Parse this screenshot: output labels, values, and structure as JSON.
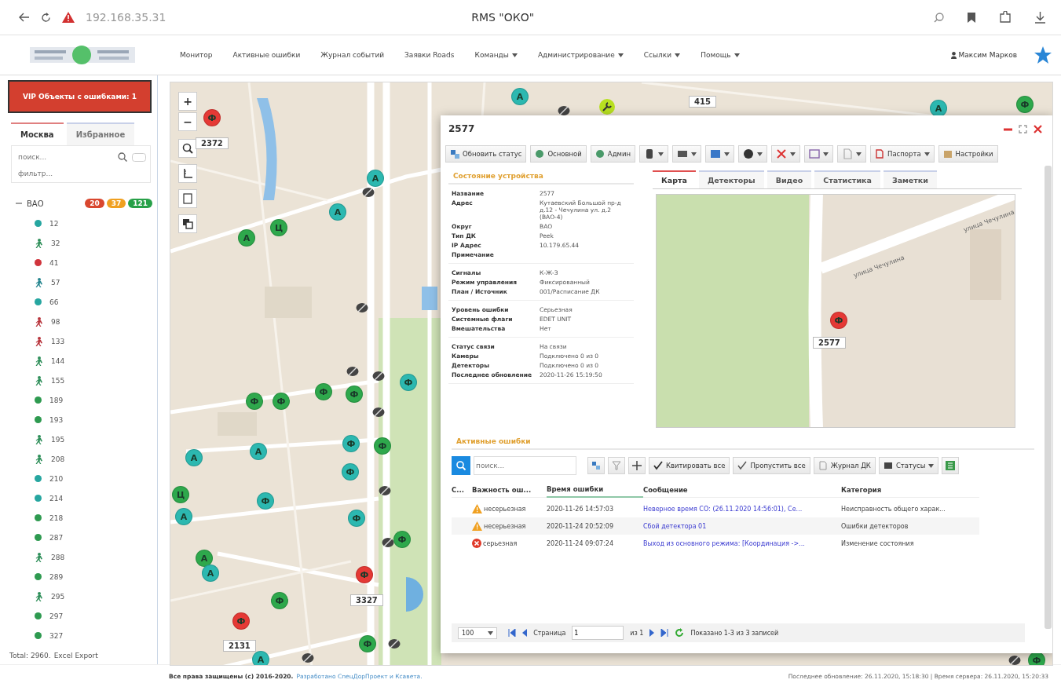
{
  "browser": {
    "address": "192.168.35.31",
    "title": "RMS \"ОКО\""
  },
  "nav": {
    "items": [
      {
        "label": "Монитор",
        "dropdown": false
      },
      {
        "label": "Активные ошибки",
        "dropdown": false
      },
      {
        "label": "Журнал событий",
        "dropdown": false
      },
      {
        "label": "Заявки Roads",
        "dropdown": false
      },
      {
        "label": "Команды",
        "dropdown": true
      },
      {
        "label": "Администрирование",
        "dropdown": true
      },
      {
        "label": "Ссылки",
        "dropdown": true
      },
      {
        "label": "Помощь",
        "dropdown": true
      }
    ],
    "user": "Максим Марков"
  },
  "sidebar": {
    "vip_banner": "VIP Объекты с ошибками: 1",
    "tabs": [
      {
        "label": "Москва",
        "selected": true
      },
      {
        "label": "Избранное",
        "selected": false
      }
    ],
    "search": {
      "placeholder": "поиск..."
    },
    "filter": {
      "placeholder": "фильтр..."
    },
    "tree": [
      {
        "label": "ВАО",
        "expanded": true,
        "counts": [
          {
            "text": "20",
            "color": "#d9472f"
          },
          {
            "text": "37",
            "color": "#f0a020"
          },
          {
            "text": "121",
            "color": "#27a048"
          }
        ],
        "children": [
          {
            "label": "12",
            "kind": "dot",
            "color": "#26a6a0"
          },
          {
            "label": "32",
            "kind": "walker",
            "color": "#2f8f5a"
          },
          {
            "label": "41",
            "kind": "dot",
            "color": "#d0343c"
          },
          {
            "label": "57",
            "kind": "walker",
            "color": "#26868f"
          },
          {
            "label": "66",
            "kind": "dot",
            "color": "#26a6a0"
          },
          {
            "label": "98",
            "kind": "walker",
            "color": "#b8343c"
          },
          {
            "label": "133",
            "kind": "walker",
            "color": "#b8343c"
          },
          {
            "label": "144",
            "kind": "walker",
            "color": "#2f8f5a"
          },
          {
            "label": "155",
            "kind": "walker",
            "color": "#2f8f5a"
          },
          {
            "label": "189",
            "kind": "dot",
            "color": "#2e9a50"
          },
          {
            "label": "193",
            "kind": "dot",
            "color": "#2e9a50"
          },
          {
            "label": "195",
            "kind": "walker",
            "color": "#2f8f5a"
          },
          {
            "label": "208",
            "kind": "walker",
            "color": "#2f8f5a"
          },
          {
            "label": "210",
            "kind": "dot",
            "color": "#26a6a0"
          },
          {
            "label": "214",
            "kind": "dot",
            "color": "#26a6a0"
          },
          {
            "label": "218",
            "kind": "dot",
            "color": "#2e9a50"
          },
          {
            "label": "287",
            "kind": "dot",
            "color": "#2e9a50"
          },
          {
            "label": "288",
            "kind": "walker",
            "color": "#2f8f5a"
          },
          {
            "label": "289",
            "kind": "dot",
            "color": "#2e9a50"
          },
          {
            "label": "295",
            "kind": "walker",
            "color": "#2f8f5a"
          },
          {
            "label": "297",
            "kind": "dot",
            "color": "#2e9a50"
          },
          {
            "label": "327",
            "kind": "dot",
            "color": "#2e9a50"
          }
        ]
      }
    ],
    "total": "Total: 2960.",
    "export_link": "Excel Export"
  },
  "map": {
    "controls": [
      "+",
      "−"
    ],
    "markers": [
      {
        "letter": "Ф",
        "color": "#e53935"
      },
      {
        "letter": "А",
        "color": "#2cb8b0"
      },
      {
        "letter": "А",
        "color": "#2cb8b0"
      },
      {
        "letter": "Ф",
        "color": "#2ea84c"
      },
      {
        "letter": "А",
        "color": "#2cb8b0"
      },
      {
        "letter": "А",
        "color": "#2cb8b0"
      },
      {
        "letter": "Ц",
        "color": "#2ea84c"
      },
      {
        "letter": "А",
        "color": "#2ea84c"
      },
      {
        "letter": "Ф",
        "color": "#2ea84c"
      },
      {
        "letter": "Ф",
        "color": "#2ea84c"
      },
      {
        "letter": "Ф",
        "color": "#2ea84c"
      },
      {
        "letter": "Ф",
        "color": "#2ea84c"
      },
      {
        "letter": "Ф",
        "color": "#2cb8b0"
      },
      {
        "letter": "Ф",
        "color": "#2cb8b0"
      },
      {
        "letter": "Ф",
        "color": "#2ea84c"
      },
      {
        "letter": "А",
        "color": "#2cb8b0"
      },
      {
        "letter": "А",
        "color": "#2cb8b0"
      },
      {
        "letter": "Ф",
        "color": "#2cb8b0"
      },
      {
        "letter": "Ф",
        "color": "#2cb8b0"
      },
      {
        "letter": "Ц",
        "color": "#2ea84c"
      },
      {
        "letter": "А",
        "color": "#2cb8b0"
      },
      {
        "letter": "Ф",
        "color": "#2cb8b0"
      },
      {
        "letter": "Ф",
        "color": "#2ea84c"
      },
      {
        "letter": "А",
        "color": "#2ea84c"
      },
      {
        "letter": "А",
        "color": "#2cb8b0"
      },
      {
        "letter": "Ф",
        "color": "#e53935"
      },
      {
        "letter": "Ф",
        "color": "#2ea84c"
      },
      {
        "letter": "Ф",
        "color": "#e53935"
      },
      {
        "letter": "А",
        "color": "#2cb8b0"
      },
      {
        "letter": "Ф",
        "color": "#2ea84c"
      },
      {
        "letter": "Ф",
        "color": "#2ea84c"
      }
    ],
    "labels": [
      "2372",
      "415",
      "3327",
      "2131"
    ]
  },
  "dialog": {
    "title": "2577",
    "toolbar": [
      {
        "kind": "text",
        "label": "Обновить статус",
        "dropdown": false
      },
      {
        "kind": "text",
        "label": "Основной",
        "dropdown": false
      },
      {
        "kind": "text",
        "label": "Админ",
        "dropdown": false
      },
      {
        "kind": "icon",
        "dropdown": true
      },
      {
        "kind": "icon",
        "dropdown": true
      },
      {
        "kind": "icon",
        "dropdown": true
      },
      {
        "kind": "icon",
        "dropdown": true
      },
      {
        "kind": "icon",
        "dropdown": true
      },
      {
        "kind": "icon",
        "dropdown": true
      },
      {
        "kind": "icon",
        "dropdown": true
      },
      {
        "kind": "text",
        "label": "Паспорта",
        "dropdown": true
      },
      {
        "kind": "text",
        "label": "Настройки",
        "dropdown": false
      }
    ],
    "state_title": "Состояние устройства",
    "fields": [
      [
        {
          "label": "Название",
          "value": "2577"
        },
        {
          "label": "Адрес",
          "value": "Кутаевский Большой пр-д д.12 - Чечулина ул. д.2 (ВАО-4)"
        },
        {
          "label": "Округ",
          "value": "ВАО"
        },
        {
          "label": "Тип ДК",
          "value": "Peek"
        },
        {
          "label": "IP Адрес",
          "value": "10.179.65.44"
        },
        {
          "label": "Примечание"
        }
      ],
      [
        {
          "label": "Сигналы",
          "value": "К-Ж-З"
        },
        {
          "label": "Режим управления",
          "value": "Фиксированный"
        },
        {
          "label": "План / Источник",
          "value": "001/Расписание ДК"
        }
      ],
      [
        {
          "label": "Уровень ошибки",
          "value": "Серьезная"
        },
        {
          "label": "Системные флаги",
          "value": "EDET UNIT"
        },
        {
          "label": "Вмешательства",
          "value": "Нет"
        }
      ],
      [
        {
          "label": "Статус связи",
          "value": "На связи"
        },
        {
          "label": "Камеры",
          "value": "Подключено 0 из 0"
        },
        {
          "label": "Детекторы",
          "value": "Подключено 0 из 0"
        },
        {
          "label": "Последнее обновление",
          "value": "2020-11-26 15:19:50"
        }
      ]
    ],
    "tabs": [
      {
        "label": "Карта",
        "selected": true
      },
      {
        "label": "Детекторы",
        "selected": false
      },
      {
        "label": "Видео",
        "selected": false
      },
      {
        "label": "Статистика",
        "selected": false
      },
      {
        "label": "Заметки",
        "selected": false
      }
    ],
    "inset_map": {
      "street_labels": [
        "улица Чечулина",
        "улица Чечулина"
      ],
      "marker": {
        "letter": "Ф",
        "color": "#e53935"
      },
      "label": "2577"
    },
    "errors_title": "Активные ошибки",
    "errors_search": {
      "placeholder": "поиск..."
    },
    "errors_toolbar": [
      {
        "kind": "icon"
      },
      {
        "kind": "icon"
      },
      {
        "kind": "icon"
      },
      {
        "kind": "text",
        "label": "Квитировать все",
        "dropdown": false
      },
      {
        "kind": "text",
        "label": "Пропустить все",
        "dropdown": false
      },
      {
        "kind": "text",
        "label": "Журнал ДК",
        "dropdown": false
      },
      {
        "kind": "text",
        "label": "Статусы",
        "dropdown": true
      },
      {
        "kind": "icon"
      }
    ],
    "columns": [
      {
        "label": "С...",
        "sorted": false
      },
      {
        "label": "Важность ош...",
        "sorted": false
      },
      {
        "label": "Время ошибки",
        "sorted": true
      },
      {
        "label": "Сообщение",
        "sorted": false
      },
      {
        "label": "Категория",
        "sorted": false
      }
    ],
    "rows": [
      {
        "kind": "warning",
        "severity": "несерьезная",
        "time": "2020-11-26 14:57:03",
        "message": "Неверное время СО: (26.11.2020 14:56:01), Се...",
        "category": "Неисправность общего харак..."
      },
      {
        "kind": "warning",
        "severity": "несерьезная",
        "time": "2020-11-24 20:52:09",
        "message": "Сбой детектора 01",
        "category": "Ошибки детекторов"
      },
      {
        "kind": "error",
        "severity": "серьезная",
        "time": "2020-11-24 09:07:24",
        "message": "Выход из основного режима: [Координация ->...",
        "category": "Изменение состояния"
      }
    ],
    "pager": {
      "page_size": "100",
      "page_label": "Страница",
      "page": "1",
      "of": "из 1",
      "summary": "Показано 1-3 из 3 записей"
    }
  },
  "footer": {
    "copyright": "Все права защищены (c) 2016-2020.",
    "credits": "Разработано СпецДорПроект и Ксавета.",
    "status": "Последнее обновление: 26.11.2020, 15:18:30 | Время сервера: 26.11.2020, 15:20:33"
  }
}
